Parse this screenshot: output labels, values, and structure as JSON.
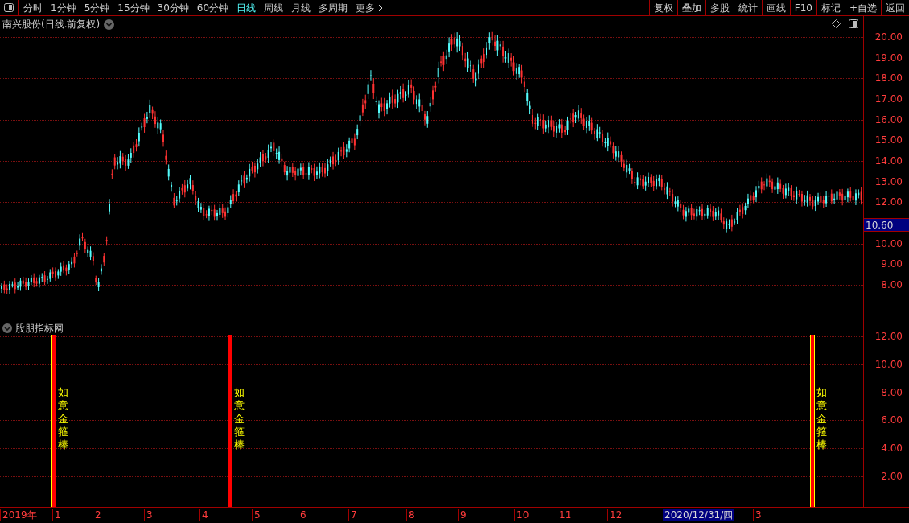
{
  "toolbar": {
    "periods": [
      {
        "label": "分时",
        "selected": false
      },
      {
        "label": "1分钟",
        "selected": false
      },
      {
        "label": "5分钟",
        "selected": false
      },
      {
        "label": "15分钟",
        "selected": false
      },
      {
        "label": "30分钟",
        "selected": false
      },
      {
        "label": "60分钟",
        "selected": false
      },
      {
        "label": "日线",
        "selected": true
      },
      {
        "label": "周线",
        "selected": false
      },
      {
        "label": "月线",
        "selected": false
      },
      {
        "label": "多周期",
        "selected": false
      },
      {
        "label": "更多",
        "selected": false
      }
    ],
    "buttons": [
      "复权",
      "叠加",
      "多股",
      "统计",
      "画线",
      "F10",
      "标记",
      "+自选",
      "返回"
    ]
  },
  "price_chart": {
    "title": "南兴股份(日线.前复权)",
    "y_labels": [
      "20.00",
      "19.00",
      "18.00",
      "17.00",
      "16.00",
      "15.00",
      "14.00",
      "13.00",
      "12.00",
      "10.00",
      "9.00",
      "8.00"
    ],
    "cursor_price": "10.60"
  },
  "indicator": {
    "title": "股朋指标网",
    "y_labels": [
      "12.00",
      "10.00",
      "8.00",
      "6.00",
      "4.00",
      "2.00"
    ],
    "signals": [
      {
        "label": "如意金箍棒"
      },
      {
        "label": "如意金箍棒"
      },
      {
        "label": "如意金箍棒"
      }
    ]
  },
  "x_axis": [
    {
      "label": "2019年",
      "kind": "tick"
    },
    {
      "label": "1",
      "kind": "tick"
    },
    {
      "label": "2",
      "kind": "tick"
    },
    {
      "label": "3",
      "kind": "tick"
    },
    {
      "label": "4",
      "kind": "tick"
    },
    {
      "label": "5",
      "kind": "tick"
    },
    {
      "label": "6",
      "kind": "tick"
    },
    {
      "label": "7",
      "kind": "tick"
    },
    {
      "label": "8",
      "kind": "tick"
    },
    {
      "label": "9",
      "kind": "tick"
    },
    {
      "label": "10",
      "kind": "tick"
    },
    {
      "label": "11",
      "kind": "tick"
    },
    {
      "label": "12",
      "kind": "tick"
    },
    {
      "label": "2020/12/31/四",
      "kind": "cursor"
    },
    {
      "label": "3",
      "kind": "tick"
    }
  ]
}
